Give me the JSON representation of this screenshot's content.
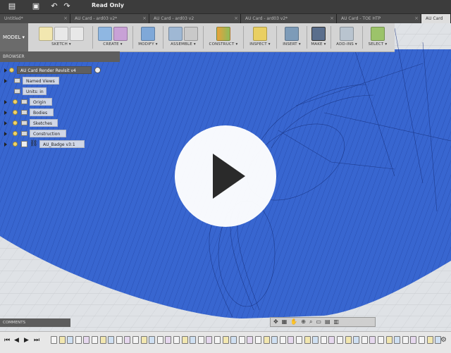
{
  "app": {
    "title": "Read Only"
  },
  "tabs": [
    {
      "label": "Untitled*"
    },
    {
      "label": "AU Card - ard03 v2*"
    },
    {
      "label": "AU Card - ard03 v2"
    },
    {
      "label": "AU Card - ard03 v2*"
    },
    {
      "label": "AU Card - TOE HTP"
    },
    {
      "label": "AU Card"
    }
  ],
  "toolbar": {
    "workspace_label": "MODEL",
    "groups": [
      {
        "label": "SKETCH"
      },
      {
        "label": "CREATE"
      },
      {
        "label": "MODIFY"
      },
      {
        "label": "ASSEMBLE"
      },
      {
        "label": "CONSTRUCT"
      },
      {
        "label": "INSPECT"
      },
      {
        "label": "INSERT"
      },
      {
        "label": "MAKE"
      },
      {
        "label": "ADD-INS"
      },
      {
        "label": "SELECT"
      }
    ]
  },
  "browser": {
    "header": "BROWSER",
    "root": "AU Card Render Revisit v4",
    "items": [
      {
        "label": "Named Views"
      },
      {
        "label": "Units: in"
      },
      {
        "label": "Origin"
      },
      {
        "label": "Bodies"
      },
      {
        "label": "Sketches"
      },
      {
        "label": "Construction"
      },
      {
        "label": "AU_Badge v3:1"
      }
    ]
  },
  "comments": {
    "label": "COMMENTS"
  },
  "colors": {
    "body_blue": "#3a6bd3",
    "toolbar_bg": "#d4d4d4",
    "play_circle": "#ffffff"
  }
}
